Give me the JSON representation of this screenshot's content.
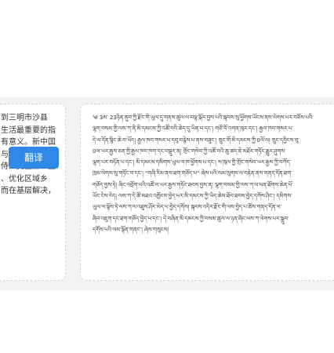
{
  "source_panel": {
    "text": "到三明市沙县\n生活最重要的指\n有意义。新中国\n与一些发达国家\n侍人民至上、生\n、优化区域乡\n而在基层解决，"
  },
  "translate_button": {
    "label": "翻译",
    "color": "#2e88e5"
  },
  "target_panel": {
    "text": "༄ 3མ་ 23ཉིན་ནུབ་ཀྱི་རྫོང་གི་ཡུལ་དུ་གནས་ཚུལ་ལ་བལྟ་སྐོར་བྱས་པའི་སྐབས་སུ་ཕྱོགས་ཡོངས་ནས་ལེགས་པར་བཅོས་པའི་\nལྷག་བསམ་གྱི་ལས་ཀ་ནི་མི་དམངས་ཀྱི་འཚོ་བའི་ཆེད་དུ་ཡིན་པ་དང་། གཙོ་བོ་འགན་ཁུར་དང་། རྒྱལ་ཁབ་གསར་པ་\nདེ་ལ་དོན་སྙིང་ཆེ་བ་ཡོད། རྒྱལ་ཁབ་གསར་པ་དབུ་བརྙེས་པ་ནས་བཟུང་། ཁྲུང་གོ་མི་དམངས་ཀྱི་0ལོ་ལ། ཁྲུང་དབྱིངས་བུ་\n0ལ་ཡར་རྒྱས་ཅན་གྱི་རྒྱལ་ཁབ་ཁག་དང་བསྡུར་ན། གྲོང་གསེབ་ཀྱི་འཚོ་བའི་ཆུ་ཚད་ཇེ་མཐོར་གཏོང་རྒྱུར་ཤུགས་\nལྷག་པར་བཏོན་པ་དང་། མི་དམངས་དམིགས་ཡུལ་ལ་ཁ་ཕྱོགས་པ་དང་། ས་ཁུལ་གྱི་གྲོང་གསེབ་ཡར་རྒྱས་ཀྱི་བཀོད་\nཁྲམ་ལེགས་སུ་གཏོང་བ་དང་། \"གཞི་རིམ་ནས་ཐག་གཅོད་པ\" ཞེས་པའི་ལམ་ལུགས་ལ་བརྟེན་ནས་གནད་དོན་ཐག་\nགཅོད་བྱས་ཏེ། ཞིང་འབྲོག་པའི་འཚོ་བ་ཡར་རྒྱས་གཏོང་ཐབས་བྱས་ན། ལྷག་བསམ་གྱི་ལས་ཀ་ལ་ཕན་ཐོགས་ཆེན་པོ་\nཡོང་ངེས་རེད། ལས་ཀ་དེ་ཚོ་མཐའ་འཁྱོངས་བྱེད་པར་མི་དམངས་ཀྱི་ཡིད་ཆེས་ཐོབ་ཐབས་བྱེད་དགོས་ཤིང་། དམིགས་\nཡུལ་ལ་ལྟོས་ཏེ་ལས་ཀ་ལ་འཐུས་ཤོར་མེད་པ་བྱེད་དགོས། སྐབས་འདིར་རྫོང་གི་ལས་བྱེད་པ་ཚོས་གནད་དོན་ལ་\nཞིབ་འཇུག་དང་ཐག་གཅོད་བྱེད་པ་དང་། དེ་བཞིན་མི་དམངས་ཀྱི་བསམ་ཚུལ་ལ་ཉན་ཞིང་ལས་ཀ་ལེགས་པར་སྒྲུབ་\nདགོས་པའི་ལམ་སྟོན་གནང་། ཞེས་གསུངས།"
  }
}
